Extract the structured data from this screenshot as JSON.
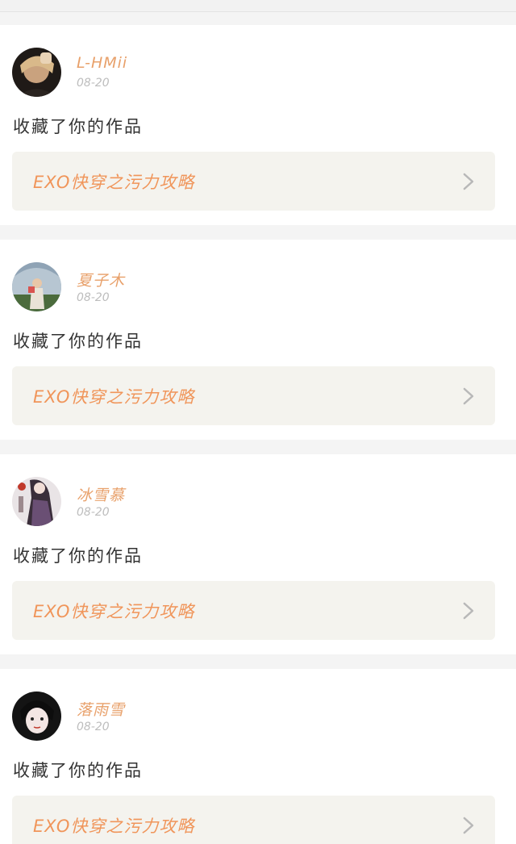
{
  "feed": {
    "items": [
      {
        "username": "L-HMii",
        "date": "08-20",
        "action_text": "收藏了你的作品",
        "work_title": "EXO快穿之污力攻略",
        "avatar_icon": "user-avatar-photo"
      },
      {
        "username": "夏子木",
        "date": "08-20",
        "action_text": "收藏了你的作品",
        "work_title": "EXO快穿之污力攻略",
        "avatar_icon": "user-avatar-photo"
      },
      {
        "username": "冰雪慕",
        "date": "08-20",
        "action_text": "收藏了你的作品",
        "work_title": "EXO快穿之污力攻略",
        "avatar_icon": "user-avatar-photo"
      },
      {
        "username": "落雨雪",
        "date": "08-20",
        "action_text": "收藏了你的作品",
        "work_title": "EXO快穿之污力攻略",
        "avatar_icon": "user-avatar-photo"
      }
    ]
  },
  "colors": {
    "accent": "#f0955a",
    "username": "#e8a06a",
    "date": "#bdbdbd",
    "box_bg": "#f4f3ee",
    "page_bg": "#f4f4f4"
  }
}
